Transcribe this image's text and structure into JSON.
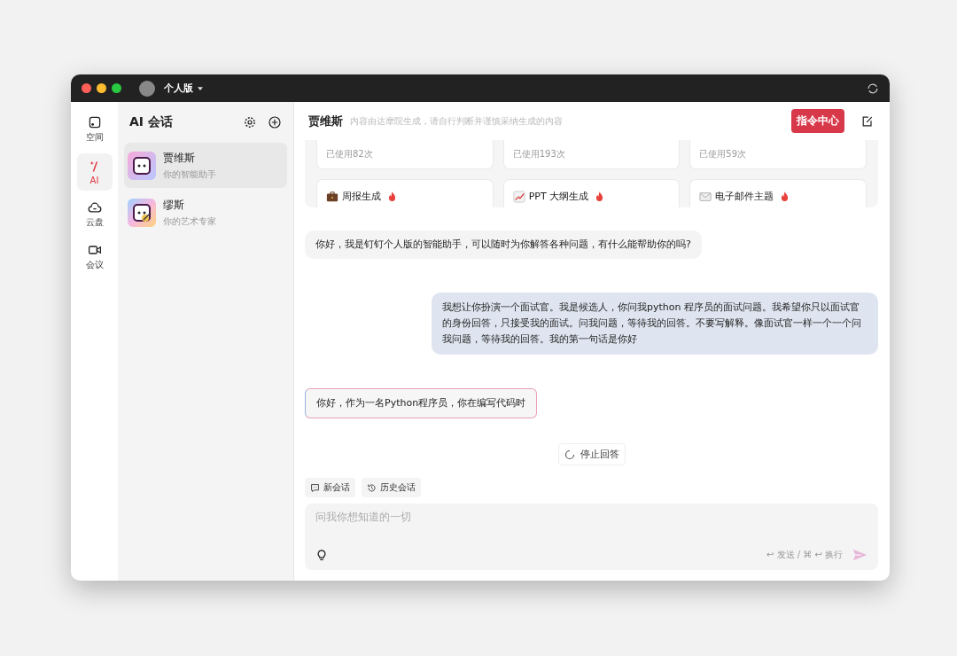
{
  "title_bar": {
    "edition": "个人版"
  },
  "nav": [
    {
      "label": "空间",
      "kind": "space",
      "selected": false
    },
    {
      "label": "AI",
      "kind": "ai",
      "selected": true
    },
    {
      "label": "云盘",
      "kind": "cloud",
      "selected": false
    },
    {
      "label": "会议",
      "kind": "meeting",
      "selected": false
    }
  ],
  "chat_list": {
    "title": "AI 会话",
    "items": [
      {
        "name": "贾维斯",
        "subtitle": "你的智能助手",
        "kind": "assistant",
        "selected": true
      },
      {
        "name": "缪斯",
        "subtitle": "你的艺术专家",
        "kind": "artist",
        "selected": false
      }
    ]
  },
  "header": {
    "name": "贾维斯",
    "disclaimer": "内容由达摩院生成，请自行判断并谨慎采纳生成的内容",
    "command_button": "指令中心"
  },
  "usage_cards": [
    {
      "usage": "已使用82次"
    },
    {
      "usage": "已使用193次"
    },
    {
      "usage": "已使用59次"
    }
  ],
  "prompt_cards": [
    {
      "label": "周报生成",
      "kind": "briefcase"
    },
    {
      "label": "PPT 大纲生成",
      "kind": "chart"
    },
    {
      "label": "电子邮件主题",
      "kind": "mail"
    }
  ],
  "messages": [
    {
      "kind": "assistant",
      "text": "你好，我是钉钉个人版的智能助手，可以随时为你解答各种问题，有什么能帮助你的吗?"
    },
    {
      "kind": "user",
      "text": "我想让你扮演一个面试官。我是候选人，你问我python 程序员的面试问题。我希望你只以面试官的身份回答，只接受我的面试。问我问题，等待我的回答。不要写解释。像面试官一样一个一个问我问题，等待我的回答。我的第一句话是你好"
    },
    {
      "kind": "assistant",
      "text": "你好，作为一名Python程序员，你在编写代码时",
      "streaming": true
    }
  ],
  "stop_button": "停止回答",
  "quick_actions": [
    {
      "label": "新会话",
      "kind": "new"
    },
    {
      "label": "历史会话",
      "kind": "history"
    }
  ],
  "input": {
    "placeholder": "问我你想知道的一切",
    "hint": "↩ 发送 / ⌘ ↩ 换行"
  }
}
